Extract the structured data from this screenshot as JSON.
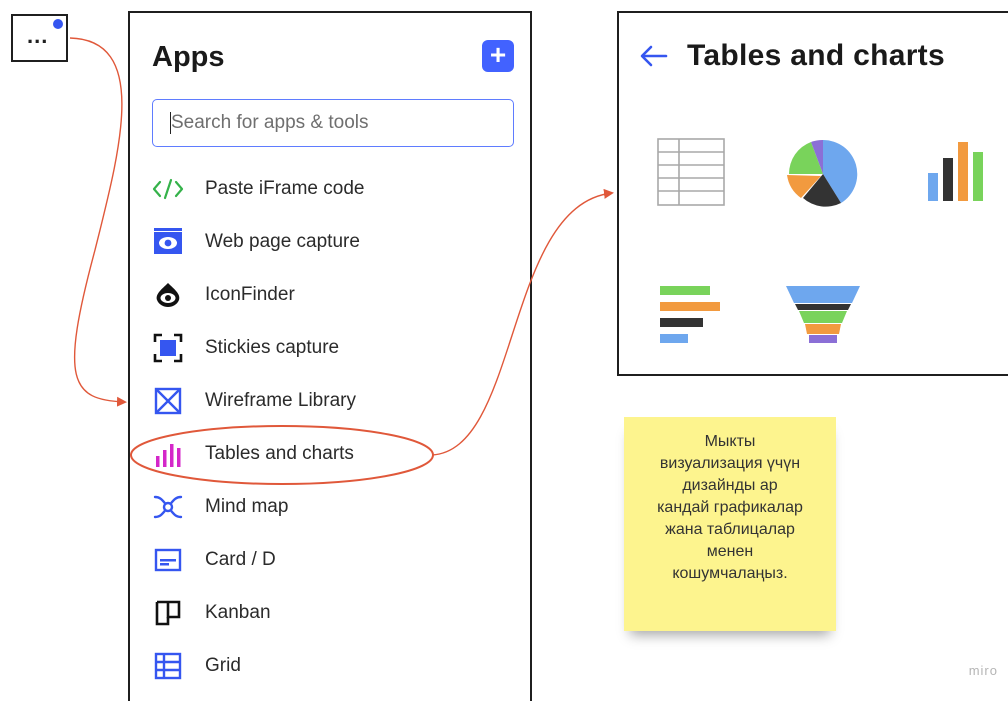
{
  "more_button": {
    "label": "...",
    "icon": "more-dots-icon"
  },
  "apps_panel": {
    "title": "Apps",
    "add_icon": "plus-icon",
    "add_label": "+",
    "search": {
      "placeholder": "Search for apps & tools",
      "value": ""
    },
    "items": [
      {
        "label": "Paste iFrame code",
        "icon": "code-icon",
        "color": "#35b24a"
      },
      {
        "label": "Web page capture",
        "icon": "web-capture-icon",
        "color": "#3556f0"
      },
      {
        "label": "IconFinder",
        "icon": "iconfinder-icon",
        "color": "#111111"
      },
      {
        "label": "Stickies capture",
        "icon": "stickies-capture-icon",
        "color": "#3556f0"
      },
      {
        "label": "Wireframe Library",
        "icon": "wireframe-icon",
        "color": "#3556f0"
      },
      {
        "label": "Tables and charts",
        "icon": "bar-chart-icon",
        "color": "#d427c9",
        "highlighted": true
      },
      {
        "label": "Mind map",
        "icon": "mind-map-icon",
        "color": "#3556f0"
      },
      {
        "label": "Card / D",
        "icon": "card-icon",
        "color": "#3556f0"
      },
      {
        "label": "Kanban",
        "icon": "kanban-icon",
        "color": "#111111"
      },
      {
        "label": "Grid",
        "icon": "grid-icon",
        "color": "#3556f0"
      }
    ]
  },
  "tables_panel": {
    "title": "Tables and charts",
    "back_icon": "arrow-left-icon",
    "items": [
      {
        "name": "table",
        "icon": "table-icon"
      },
      {
        "name": "pie-chart",
        "icon": "pie-chart-icon"
      },
      {
        "name": "column-chart",
        "icon": "column-chart-icon"
      },
      {
        "name": "bar-chart",
        "icon": "horizontal-bar-chart-icon"
      },
      {
        "name": "funnel",
        "icon": "funnel-chart-icon"
      }
    ]
  },
  "sticky_note": {
    "lines": [
      "Мыкты",
      "визуализация үчүн",
      "дизайнды ар",
      "кандай графикалар",
      "жана таблицалар",
      "менен",
      "кошумчалаңыз."
    ],
    "color": "#fdf48e"
  },
  "watermark": "miro",
  "colors": {
    "accent": "#4262ff",
    "arrow": "#e0583a",
    "highlight_ring": "#e0583a"
  }
}
